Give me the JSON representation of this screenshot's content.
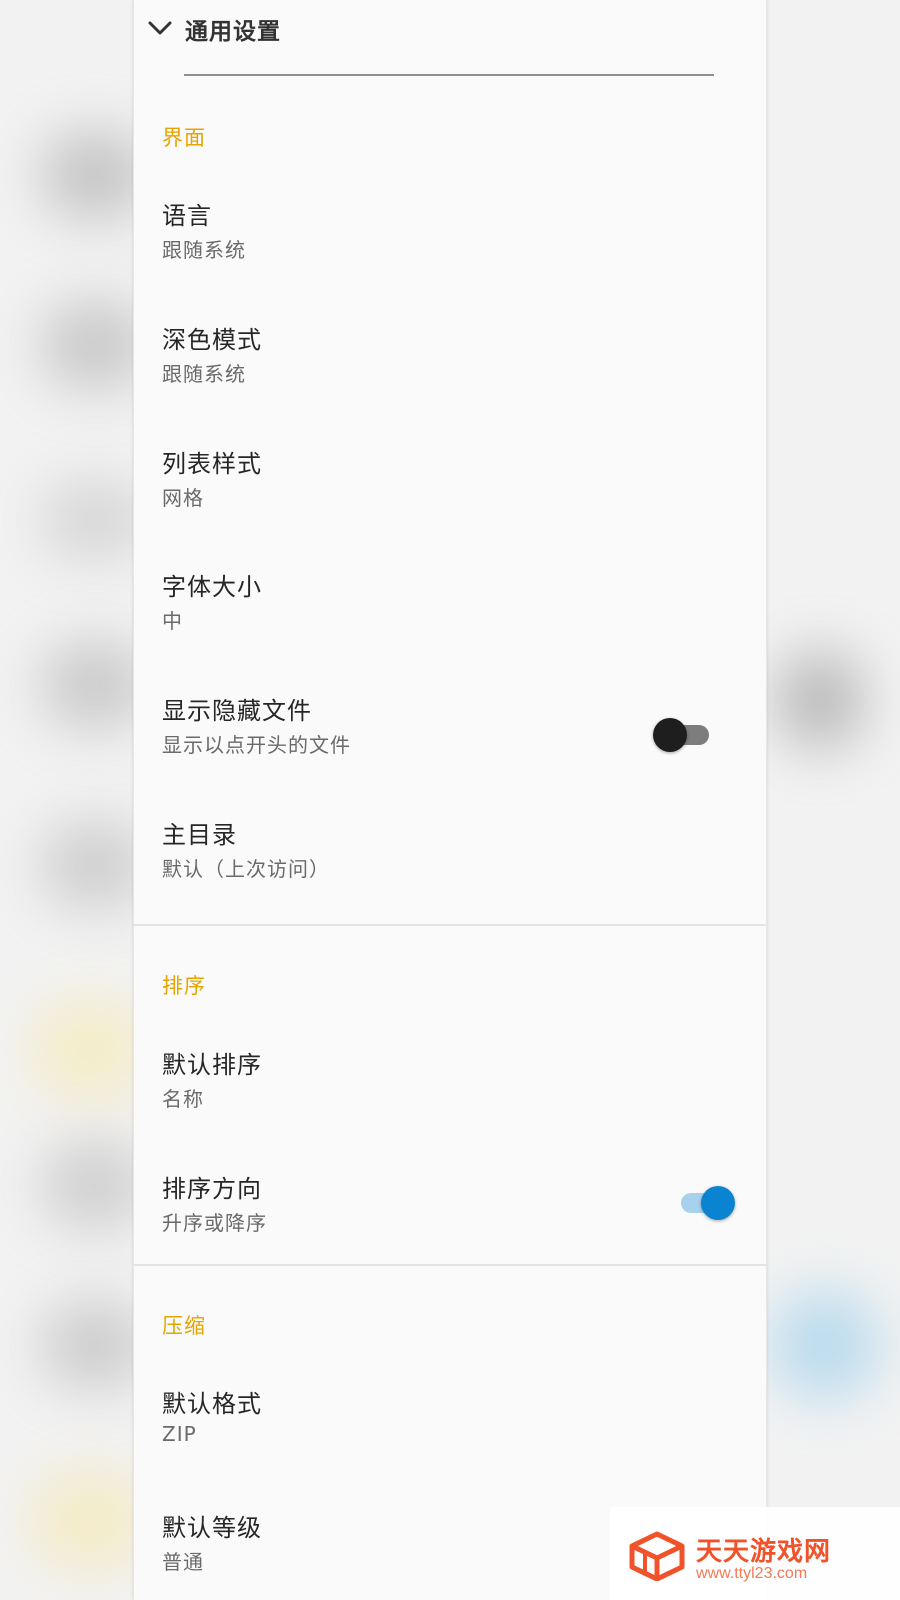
{
  "header": {
    "title": "通用设置"
  },
  "sections": [
    {
      "title": "界面",
      "items": [
        {
          "title": "语言",
          "subtitle": "跟随系统"
        },
        {
          "title": "深色模式",
          "subtitle": "跟随系统"
        },
        {
          "title": "列表样式",
          "subtitle": "网格"
        },
        {
          "title": "字体大小",
          "subtitle": "中"
        },
        {
          "title": "显示隐藏文件",
          "subtitle": "显示以点开头的文件",
          "toggle": false
        },
        {
          "title": "主目录",
          "subtitle": "默认（上次访问）"
        }
      ]
    },
    {
      "title": "排序",
      "items": [
        {
          "title": "默认排序",
          "subtitle": "名称"
        },
        {
          "title": "排序方向",
          "subtitle": "升序或降序",
          "toggle": true
        }
      ]
    },
    {
      "title": "压缩",
      "items": [
        {
          "title": "默认格式",
          "subtitle": "ZIP"
        },
        {
          "title": "默认等级",
          "subtitle": "普通"
        }
      ]
    }
  ],
  "watermark": {
    "name": "天天游戏网",
    "url": "www.ttyl23.com"
  },
  "colors": {
    "section_accent": "#e6a400",
    "toggle_on": "#0a84d0",
    "toggle_off": "#1e1e1e"
  }
}
